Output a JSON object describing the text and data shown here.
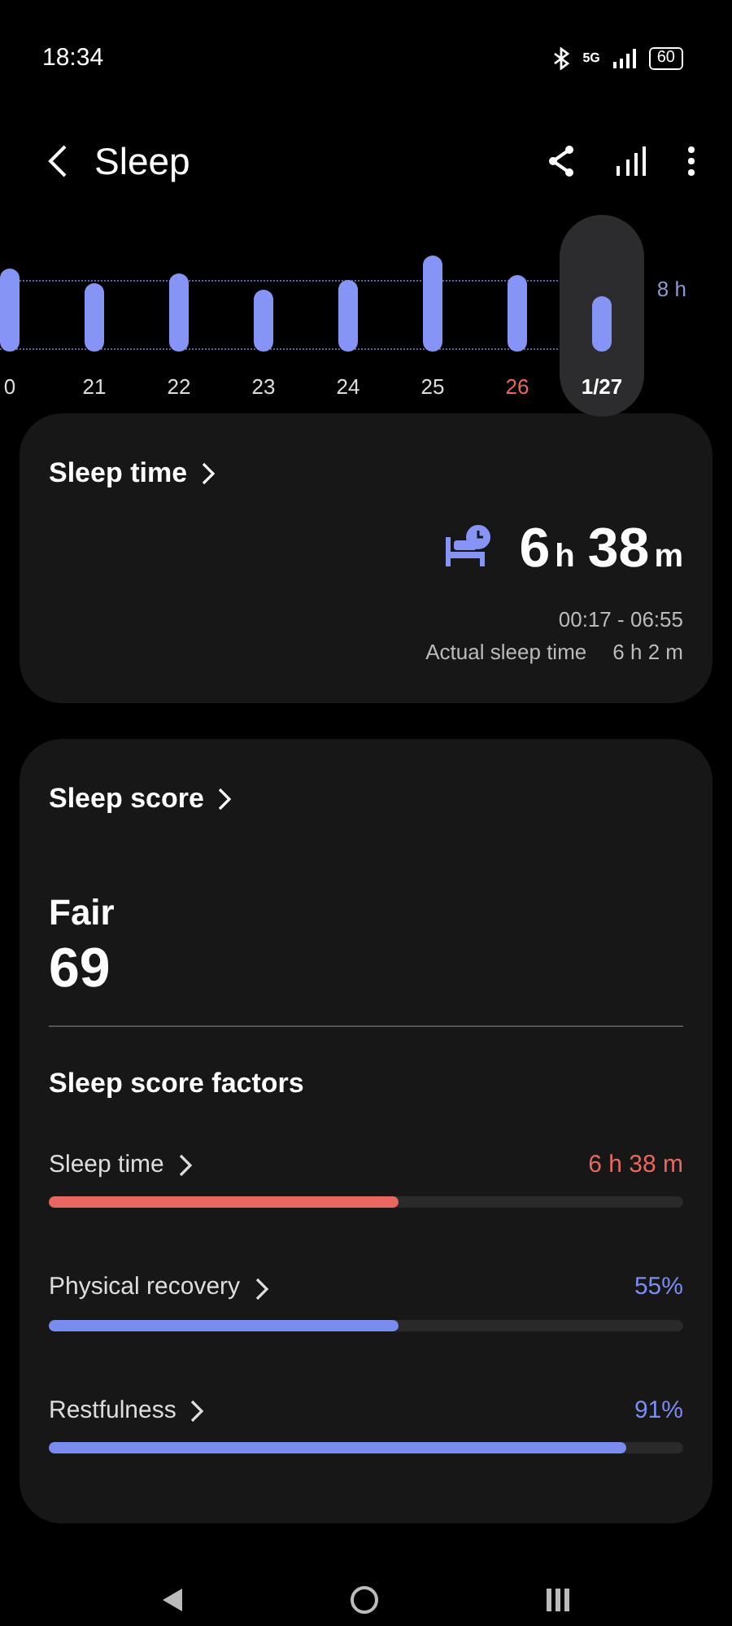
{
  "status_bar": {
    "time": "18:34",
    "network": "5G",
    "battery": "60"
  },
  "header": {
    "title": "Sleep"
  },
  "chart": {
    "reference_label": "8 h",
    "days": [
      {
        "label": "0",
        "sunday": false,
        "selected": false
      },
      {
        "label": "21",
        "sunday": false,
        "selected": false
      },
      {
        "label": "22",
        "sunday": false,
        "selected": false
      },
      {
        "label": "23",
        "sunday": false,
        "selected": false
      },
      {
        "label": "24",
        "sunday": false,
        "selected": false
      },
      {
        "label": "25",
        "sunday": false,
        "selected": false
      },
      {
        "label": "26",
        "sunday": true,
        "selected": false
      },
      {
        "label": "1/27",
        "sunday": false,
        "selected": true
      }
    ]
  },
  "sleep_time_card": {
    "title": "Sleep time",
    "hours": "6",
    "hours_unit": "h",
    "minutes": "38",
    "minutes_unit": "m",
    "range": "00:17 - 06:55",
    "actual_label": "Actual sleep time",
    "actual_value": "6 h 2 m"
  },
  "sleep_score_card": {
    "title": "Sleep score",
    "rating": "Fair",
    "score": "69",
    "factors_title": "Sleep score factors",
    "factors": [
      {
        "label": "Sleep time",
        "value": "6 h 38 m",
        "level": 0.55,
        "color": "#e8675e"
      },
      {
        "label": "Physical recovery",
        "value": "55%",
        "level": 0.55,
        "color": "#7b8cf0"
      },
      {
        "label": "Restfulness",
        "value": "91%",
        "level": 0.91,
        "color": "#7b8cf0"
      }
    ]
  }
}
